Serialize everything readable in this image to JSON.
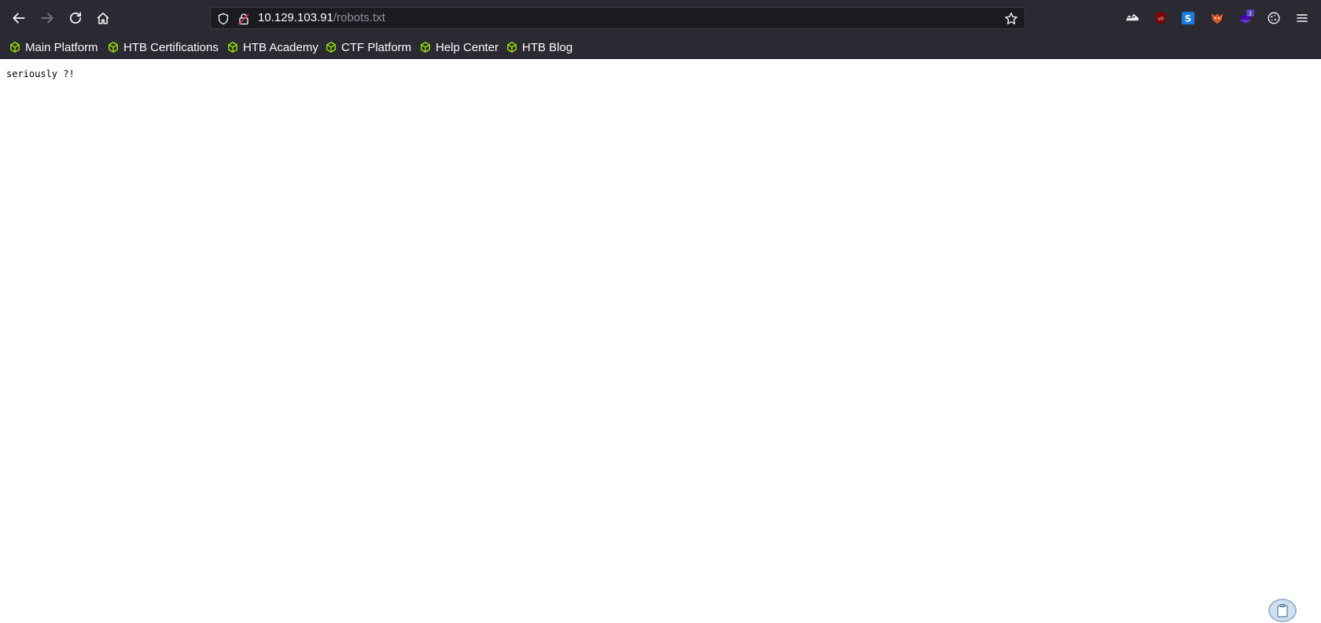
{
  "browser": {
    "url_host": "10.129.103.91",
    "url_path": "/robots.txt",
    "extension_badge": "2"
  },
  "bookmarks": [
    {
      "label": "Main Platform"
    },
    {
      "label": "HTB Certifications"
    },
    {
      "label": "HTB Academy"
    },
    {
      "label": "CTF Platform"
    },
    {
      "label": "Help Center"
    },
    {
      "label": "HTB Blog"
    }
  ],
  "page": {
    "body_text": "seriously ?!"
  },
  "colors": {
    "chrome_bg": "#2b2a33",
    "url_bg": "#1c1b22",
    "bookmark_icon": "#9fef00"
  }
}
